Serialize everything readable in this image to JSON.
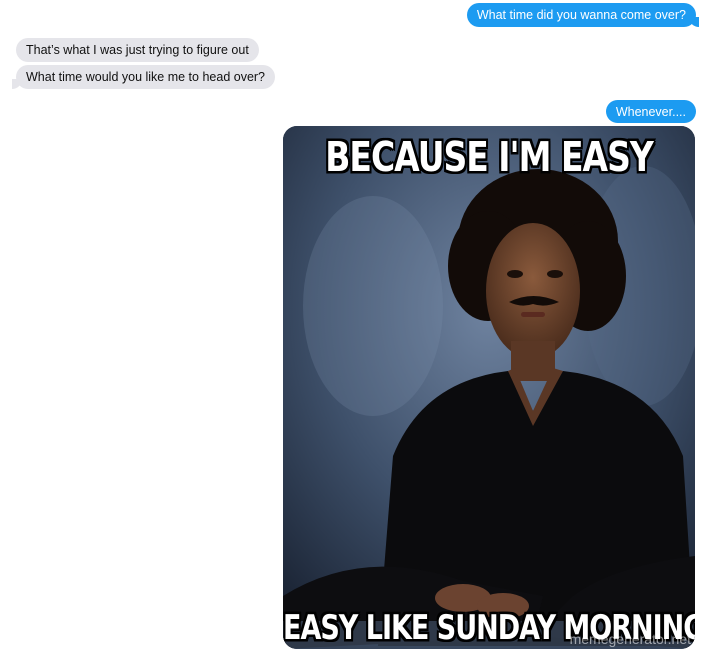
{
  "messages": {
    "sent_1": "What time did you wanna come over?",
    "received_1": "That’s what I was just trying to figure out",
    "received_2": "What time would you like me to head over?",
    "sent_2": "Whenever...."
  },
  "meme": {
    "top_text": "BECAUSE I'M EASY",
    "bottom_text": "EASY LIKE SUNDAY MORNING",
    "watermark": "memegenerator.net"
  },
  "colors": {
    "sent_bubble": "#1c9bf1",
    "received_bubble": "#e5e5ea"
  }
}
